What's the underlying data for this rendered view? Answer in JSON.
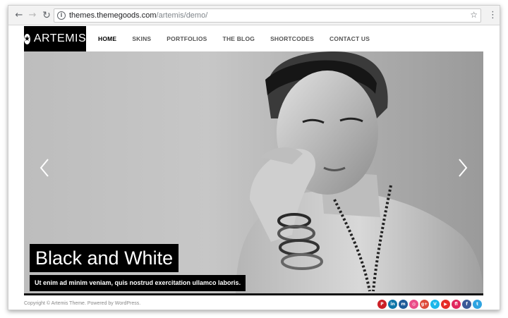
{
  "browser": {
    "url_host": "themes.themegoods.com",
    "url_path": "/artemis/demo/",
    "back_glyph": "←",
    "forward_glyph": "→",
    "reload_glyph": "↻",
    "info_glyph": "i",
    "star_glyph": "☆",
    "menu_glyph": "⋮"
  },
  "header": {
    "logo_text": "ARTEMIS",
    "logo_icon": "star-circle-icon",
    "logo_glyph": "★",
    "nav": [
      {
        "label": "HOME",
        "active": true
      },
      {
        "label": "SKINS",
        "active": false
      },
      {
        "label": "PORTFOLIOS",
        "active": false
      },
      {
        "label": "THE BLOG",
        "active": false
      },
      {
        "label": "SHORTCODES",
        "active": false
      },
      {
        "label": "CONTACT US",
        "active": false
      }
    ]
  },
  "slider": {
    "title": "Black and White",
    "caption": "Ut enim ad minim veniam, quis nostrud exercitation ullamco laboris.",
    "prev_icon": "chevron-left-icon",
    "next_icon": "chevron-right-icon"
  },
  "footer": {
    "copyright": "Copyright © Artemis Theme. Powered by WordPress.",
    "social": [
      {
        "name": "pinterest-icon",
        "glyph": "P",
        "color": "#cb2027"
      },
      {
        "name": "linkedin-icon",
        "glyph": "in",
        "color": "#0e76a8"
      },
      {
        "name": "myspace-icon",
        "glyph": "m",
        "color": "#1f5c99"
      },
      {
        "name": "dribbble-icon",
        "glyph": "◎",
        "color": "#ea4c89"
      },
      {
        "name": "google-plus-icon",
        "glyph": "g+",
        "color": "#dd4b39"
      },
      {
        "name": "vimeo-icon",
        "glyph": "V",
        "color": "#1ab7ea"
      },
      {
        "name": "youtube-icon",
        "glyph": "▶",
        "color": "#e52d27"
      },
      {
        "name": "flickr-icon",
        "glyph": "fl",
        "color": "#e0265e"
      },
      {
        "name": "facebook-icon",
        "glyph": "f",
        "color": "#3b5998"
      },
      {
        "name": "twitter-icon",
        "glyph": "t",
        "color": "#2fa4e1"
      }
    ]
  },
  "colors": {
    "logo_bg": "#000000",
    "nav_text": "#555555",
    "nav_active": "#000000",
    "caption_bg": "#000000",
    "caption_text": "#ffffff"
  }
}
